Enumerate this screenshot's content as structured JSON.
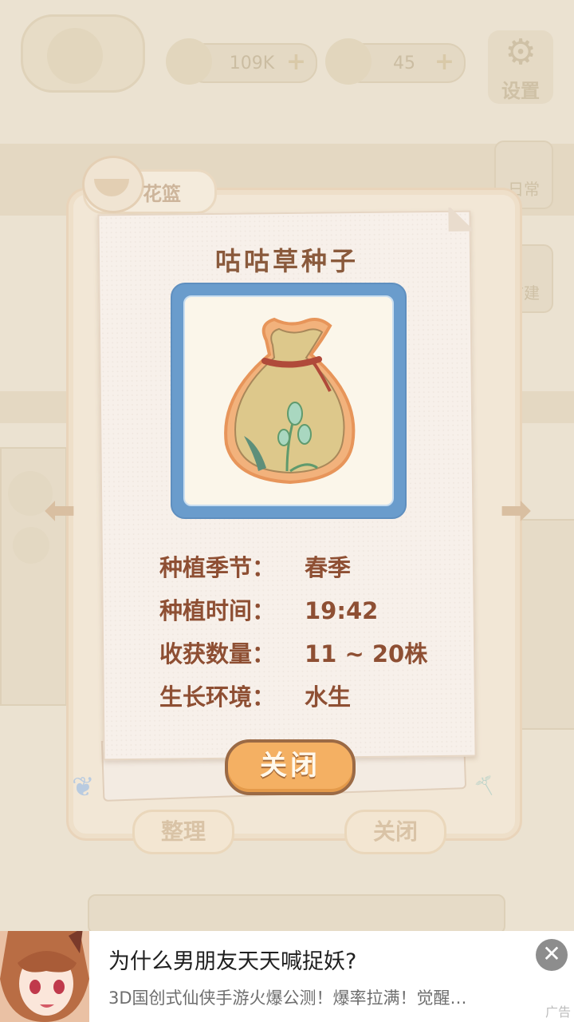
{
  "hud": {
    "fish_value": "109K",
    "cheese_value": "45",
    "settings_label": "设置",
    "side_buttons": [
      "日常",
      "扩建"
    ]
  },
  "basket": {
    "tab_label": "花篮",
    "sort_button": "整理",
    "close_button": "关闭"
  },
  "detail": {
    "title": "咕咕草种子",
    "icon": "seed-bag-icon",
    "rows": [
      {
        "label": "种植季节：",
        "value": "春季"
      },
      {
        "label": "种植时间：",
        "value": "19:42"
      },
      {
        "label": "收获数量：",
        "value": "11 ~ 20株"
      },
      {
        "label": "生长环境：",
        "value": "水生"
      }
    ],
    "close_button": "关闭"
  },
  "ad": {
    "title": "为什么男朋友天天喊捉妖?",
    "description": "3D国创式仙侠手游火爆公测！爆率拉满！觉醒…",
    "label": "广告",
    "close_symbol": "✕"
  },
  "colors": {
    "title_brown": "#8a5a3c",
    "row_text": "#8e4f33",
    "close_button_fill": "#f4b063",
    "icon_frame_blue": "#6a9ccc"
  }
}
